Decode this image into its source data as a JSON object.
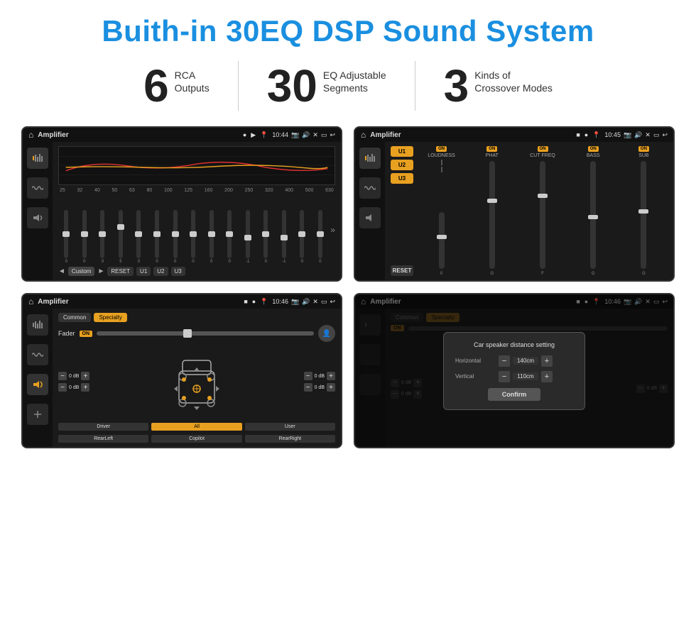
{
  "title": "Buith-in 30EQ DSP Sound System",
  "stats": [
    {
      "number": "6",
      "label": "RCA\nOutputs"
    },
    {
      "number": "30",
      "label": "EQ Adjustable\nSegments"
    },
    {
      "number": "3",
      "label": "Kinds of\nCrossover Modes"
    }
  ],
  "screens": [
    {
      "id": "screen1",
      "statusBar": {
        "appName": "Amplifier",
        "time": "10:44"
      },
      "type": "eq"
    },
    {
      "id": "screen2",
      "statusBar": {
        "appName": "Amplifier",
        "time": "10:45"
      },
      "type": "amplifier"
    },
    {
      "id": "screen3",
      "statusBar": {
        "appName": "Amplifier",
        "time": "10:46"
      },
      "type": "fader"
    },
    {
      "id": "screen4",
      "statusBar": {
        "appName": "Amplifier",
        "time": "10:46"
      },
      "type": "dialog"
    }
  ],
  "eq": {
    "freqs": [
      "25",
      "32",
      "40",
      "50",
      "63",
      "80",
      "100",
      "125",
      "160",
      "200",
      "250",
      "320",
      "400",
      "500",
      "630"
    ],
    "values": [
      "0",
      "0",
      "0",
      "5",
      "0",
      "0",
      "0",
      "0",
      "0",
      "0",
      "-1",
      "0",
      "-1",
      "0",
      "0"
    ],
    "controls": [
      "◄",
      "Custom",
      "►",
      "RESET",
      "U1",
      "U2",
      "U3"
    ]
  },
  "amplifier": {
    "presets": [
      "U1",
      "U2",
      "U3"
    ],
    "channels": [
      {
        "name": "LOUDNESS",
        "on": true
      },
      {
        "name": "PHAT",
        "on": true
      },
      {
        "name": "CUT FREQ",
        "on": true
      },
      {
        "name": "BASS",
        "on": true
      },
      {
        "name": "SUB",
        "on": true
      }
    ],
    "resetLabel": "RESET"
  },
  "fader": {
    "tabs": [
      "Common",
      "Specialty"
    ],
    "faderLabel": "Fader",
    "onLabel": "ON",
    "volumes": [
      "0 dB",
      "0 dB",
      "0 dB",
      "0 dB"
    ],
    "bottomBtns": [
      "Driver",
      "RearLeft",
      "All",
      "User",
      "Copilot",
      "RearRight"
    ]
  },
  "dialog": {
    "title": "Car speaker distance setting",
    "rows": [
      {
        "label": "Horizontal",
        "value": "140cm"
      },
      {
        "label": "Vertical",
        "value": "110cm"
      }
    ],
    "confirmLabel": "Confirm",
    "tabs": [
      "Common",
      "Specialty"
    ],
    "onLabel": "ON",
    "volumes": [
      "0 dB",
      "0 dB"
    ]
  }
}
